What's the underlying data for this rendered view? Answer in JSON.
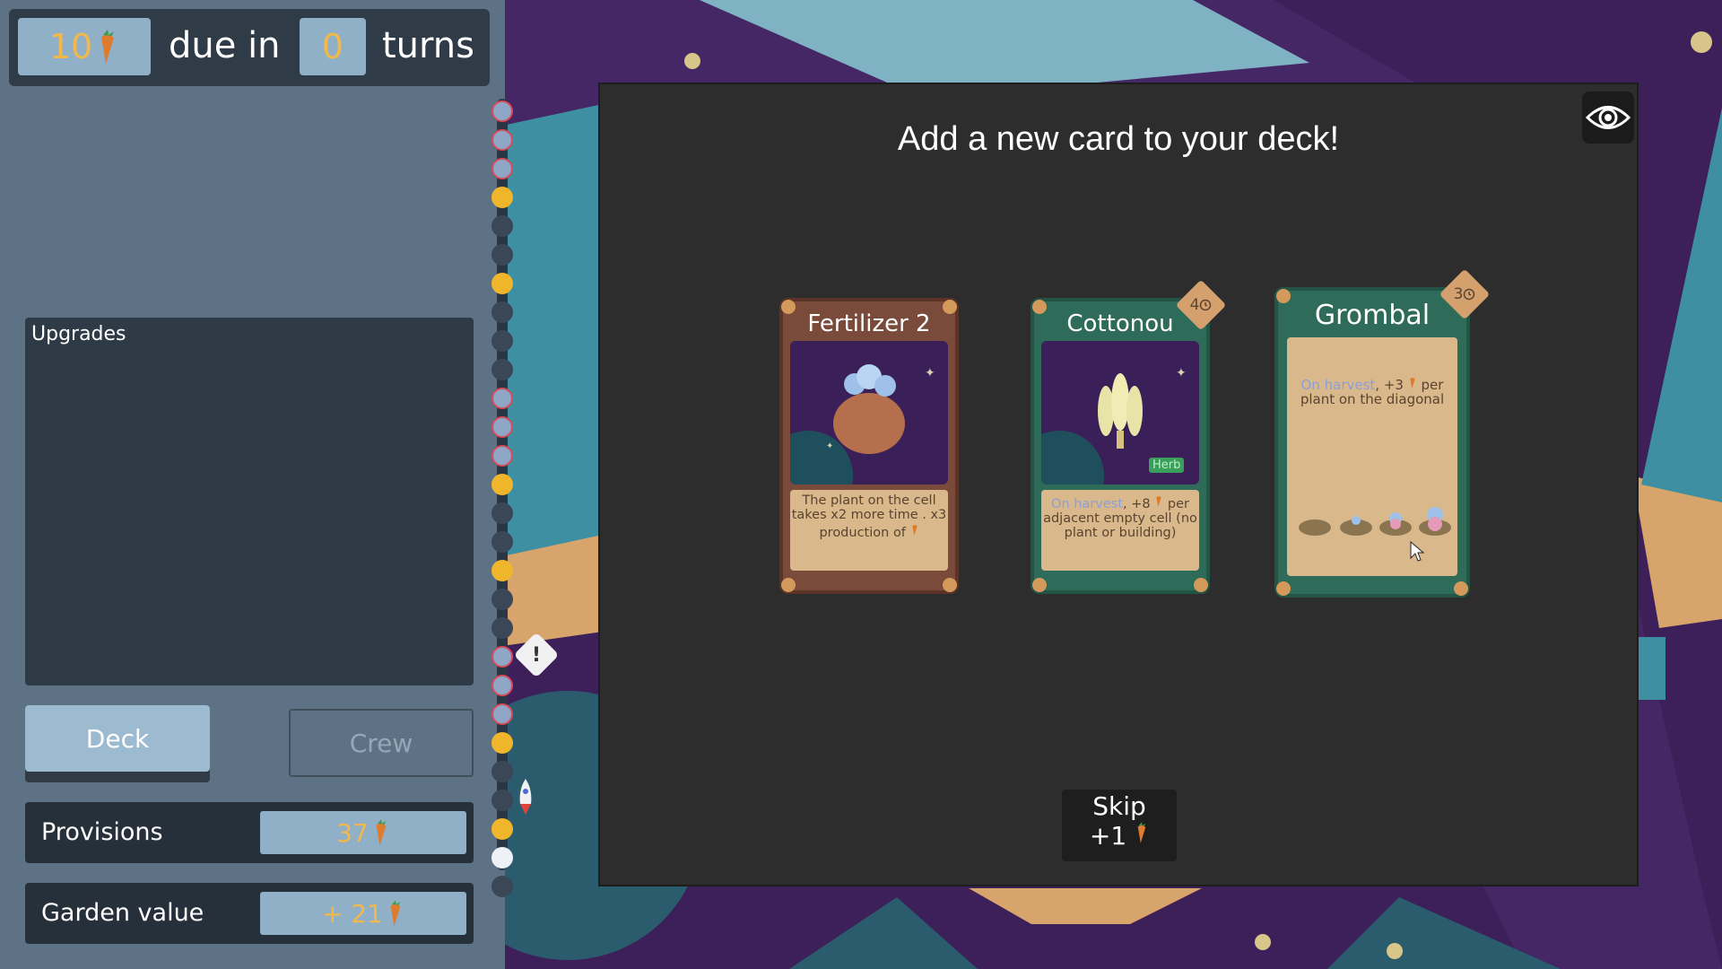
{
  "due": {
    "amount": "10",
    "text1": "due in",
    "turns_value": "0",
    "text2": "turns",
    "icon": "carrot-icon"
  },
  "upgrades": {
    "title": "Upgrades"
  },
  "buttons": {
    "deck": "Deck",
    "crew": "Crew"
  },
  "provisions": {
    "label": "Provisions",
    "value": "37"
  },
  "garden": {
    "label": "Garden value",
    "value": "+ 21"
  },
  "modal": {
    "title": "Add a new card to your deck!",
    "eye_icon": "eye-icon",
    "skip": {
      "label": "Skip",
      "reward": "+1"
    }
  },
  "cards": [
    {
      "name": "Fertilizer 2",
      "desc_a": "The plant on the cell takes x2 more time",
      "desc_b": ". x3 production of"
    },
    {
      "name": "Cottonou",
      "badge": "4",
      "tag": "Herb",
      "desc_a": "On harvest",
      "desc_b": ", +8",
      "desc_c": "per adjacent empty cell (no plant or building)"
    },
    {
      "name": "Grombal",
      "badge": "3",
      "desc_a": "On harvest",
      "desc_b": ", +3",
      "desc_c": "per plant on the diagonal"
    }
  ],
  "colors": {
    "sidebar": "#5d7385",
    "modal": "#2d2d2d",
    "accent_gold": "#f2b84b",
    "value_box": "#8fb0c6"
  }
}
